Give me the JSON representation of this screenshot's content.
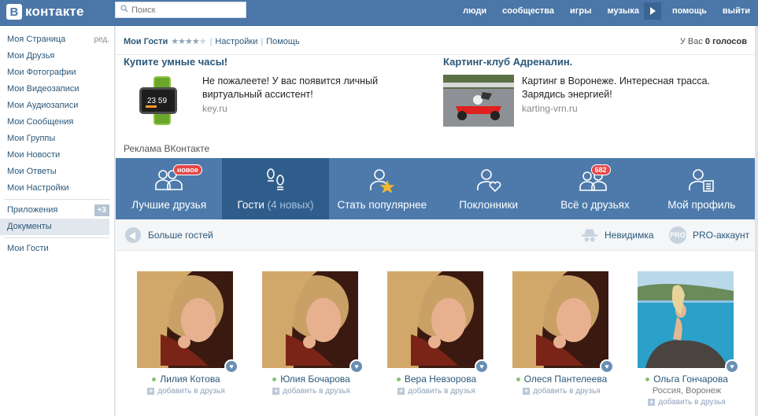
{
  "header": {
    "logo": "контакте",
    "logo_letter": "В",
    "search_placeholder": "Поиск",
    "nav": [
      "люди",
      "сообщества",
      "игры",
      "музыка",
      "помощь",
      "выйти"
    ]
  },
  "sidebar": {
    "items": [
      {
        "label": "Моя Страница",
        "extra": "ред."
      },
      {
        "label": "Мои Друзья"
      },
      {
        "label": "Мои Фотографии"
      },
      {
        "label": "Мои Видеозаписи"
      },
      {
        "label": "Мои Аудиозаписи"
      },
      {
        "label": "Мои Сообщения"
      },
      {
        "label": "Мои Группы"
      },
      {
        "label": "Мои Новости"
      },
      {
        "label": "Мои Ответы"
      },
      {
        "label": "Мои Настройки"
      }
    ],
    "apps": {
      "label": "Приложения",
      "badge": "+3"
    },
    "docs": {
      "label": "Документы"
    },
    "guests": {
      "label": "Мои Гости"
    }
  },
  "app_header": {
    "title": "Мои Гости",
    "rating": 4,
    "settings": "Настройки",
    "help": "Помощь",
    "votes_prefix": "У Вас",
    "votes_count": "0 голосов"
  },
  "ads": [
    {
      "title": "Купите умные часы!",
      "text": "Не пожалеете! У вас появится личный виртуальный ассистент!",
      "url": "key.ru"
    },
    {
      "title": "Картинг-клуб Адреналин.",
      "text": "Картинг в Воронеже. Интересная трасса. Зарядись энергией!",
      "url": "karting-vrn.ru"
    }
  ],
  "ad_label": "Реклама ВКонтакте",
  "tabs": [
    {
      "label": "Лучшие друзья",
      "badge": "новое",
      "icon": "best-friends-icon"
    },
    {
      "label": "Гости",
      "sub": "(4 новых)",
      "icon": "footprints-icon"
    },
    {
      "label": "Стать популярнее",
      "icon": "user-star-icon"
    },
    {
      "label": "Поклонники",
      "icon": "user-heart-icon"
    },
    {
      "label": "Всё о друзьях",
      "badge": "682",
      "icon": "friends-info-icon"
    },
    {
      "label": "Мой профиль",
      "icon": "profile-card-icon"
    }
  ],
  "subbar": {
    "more_guests": "Больше гостей",
    "invisible": "Невидимка",
    "pro_label": "PRO-аккаунт",
    "pro_icon_text": "PRO"
  },
  "guests": [
    {
      "name": "Лилия Котова",
      "location": "",
      "add": "добавить в друзья"
    },
    {
      "name": "Юлия Бочарова",
      "location": "",
      "add": "добавить в друзья"
    },
    {
      "name": "Вера Невзорова",
      "location": "",
      "add": "добавить в друзья"
    },
    {
      "name": "Олеся Пантелеева",
      "location": "",
      "add": "добавить в друзья"
    },
    {
      "name": "Ольга Гончарова",
      "location": "Россия, Воронеж",
      "add": "добавить в друзья"
    }
  ],
  "colors": {
    "brand": "#4a76a8",
    "tab_active": "#2f5d8b",
    "link": "#2b587a",
    "badge": "#e64646",
    "online": "#8ac176"
  }
}
